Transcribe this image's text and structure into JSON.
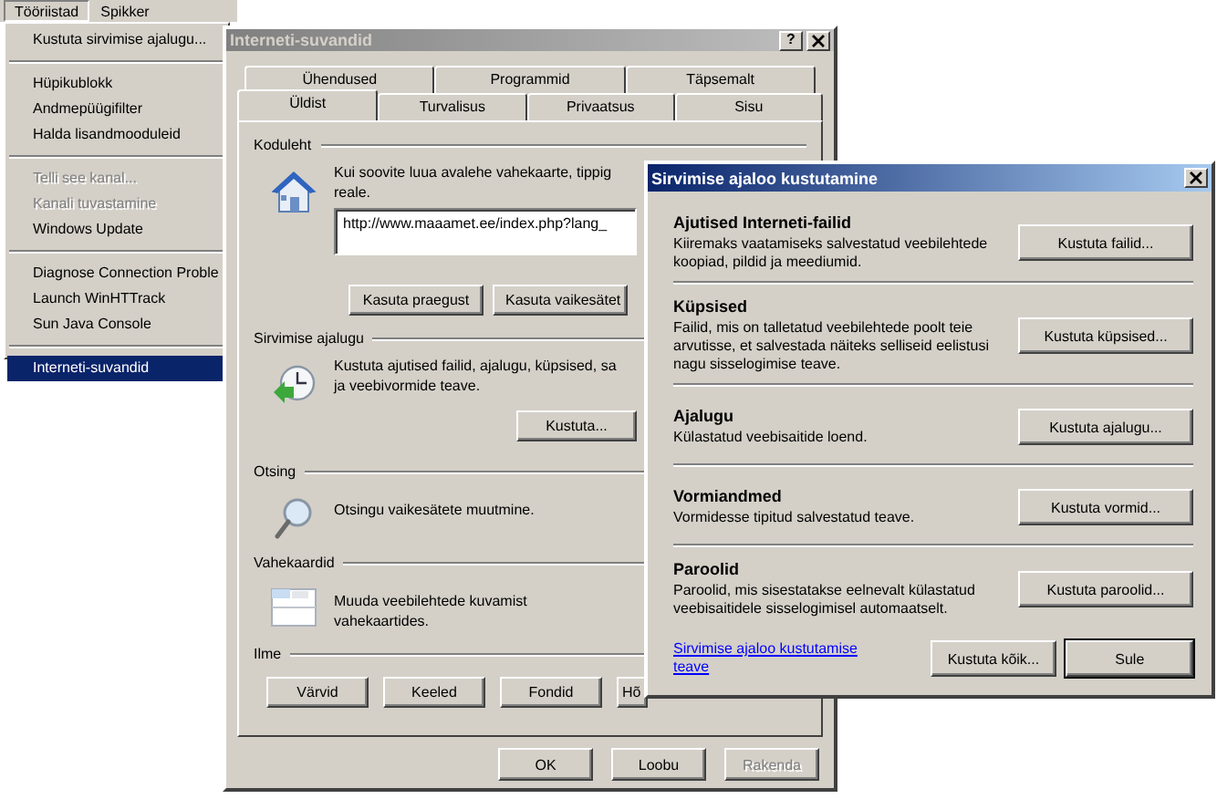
{
  "menu_bar": [
    {
      "label": "Tööriistad",
      "selected": true
    },
    {
      "label": "Spikker",
      "selected": false
    }
  ],
  "menu": {
    "groups": [
      [
        {
          "label": "Kustuta sirvimise ajalugu...",
          "disabled": false,
          "selected": false
        }
      ],
      [
        {
          "label": "Hüpikublokk",
          "disabled": false,
          "selected": false
        },
        {
          "label": "Andmepüügifilter",
          "disabled": false,
          "selected": false
        },
        {
          "label": "Halda lisandmooduleid",
          "disabled": false,
          "selected": false
        }
      ],
      [
        {
          "label": "Telli see kanal...",
          "disabled": true,
          "selected": false
        },
        {
          "label": "Kanali tuvastamine",
          "disabled": true,
          "selected": false
        },
        {
          "label": "Windows Update",
          "disabled": false,
          "selected": false
        }
      ],
      [
        {
          "label": "Diagnose Connection Proble",
          "disabled": false,
          "selected": false
        },
        {
          "label": "Launch WinHTTrack",
          "disabled": false,
          "selected": false
        },
        {
          "label": "Sun Java Console",
          "disabled": false,
          "selected": false
        }
      ],
      [
        {
          "label": "Interneti-suvandid",
          "disabled": false,
          "selected": true
        }
      ]
    ]
  },
  "options_dialog": {
    "title": "Interneti-suvandid",
    "help_button": "?",
    "tabs_row_1": [
      {
        "label": "Ühendused",
        "selected": false
      },
      {
        "label": "Programmid",
        "selected": false
      },
      {
        "label": "Täpsemalt",
        "selected": false
      }
    ],
    "tabs_row_2": [
      {
        "label": "Üldist",
        "selected": true
      },
      {
        "label": "Turvalisus",
        "selected": false
      },
      {
        "label": "Privaatsus",
        "selected": false
      },
      {
        "label": "Sisu",
        "selected": false
      }
    ],
    "sections": [
      {
        "kind": "homepage",
        "heading": "Koduleht",
        "lines": [
          "Kui soovite luua avalehe vahekaarte, tippig",
          "reale."
        ],
        "url": "http://www.maaamet.ee/index.php?lang_",
        "buttons": [
          "Kasuta praegust",
          "Kasuta vaikesätet"
        ]
      },
      {
        "kind": "history",
        "heading": "Sirvimise ajalugu",
        "lines": [
          "Kustuta ajutised failid, ajalugu, küpsised, sa",
          "ja veebivormide teave."
        ],
        "buttons": [
          "Kustuta..."
        ]
      },
      {
        "kind": "search",
        "heading": "Otsing",
        "lines": [
          "Otsingu vaikesätete muutmine."
        ]
      },
      {
        "kind": "tabs",
        "heading": "Vahekaardid",
        "lines": [
          "Muuda veebilehtede kuvamist",
          "vahekaartides."
        ]
      },
      {
        "kind": "appearance",
        "heading": "Ilme",
        "buttons": [
          "Värvid",
          "Keeled",
          "Fondid",
          "Hõ"
        ]
      }
    ],
    "buttons": [
      {
        "label": "OK",
        "disabled": false
      },
      {
        "label": "Loobu",
        "disabled": false
      },
      {
        "label": "Rakenda",
        "disabled": true
      }
    ]
  },
  "delete_dialog": {
    "title": "Sirvimise ajaloo kustutamine",
    "sections": [
      {
        "title": "Ajutised Interneti-failid",
        "text": "Kiiremaks vaatamiseks salvestatud veebilehtede koopiad, pildid ja meediumid.",
        "button": "Kustuta failid..."
      },
      {
        "title": "Küpsised",
        "text": "Failid, mis on talletatud veebilehtede poolt teie arvutisse, et salvestada näiteks selliseid eelistusi nagu sisselogimise teave.",
        "button": "Kustuta küpsised..."
      },
      {
        "title": "Ajalugu",
        "text": "Külastatud veebisaitide loend.",
        "button": "Kustuta ajalugu..."
      },
      {
        "title": "Vormiandmed",
        "text": "Vormidesse tipitud salvestatud teave.",
        "button": "Kustuta vormid..."
      },
      {
        "title": "Paroolid",
        "text": "Paroolid, mis sisestatakse eelnevalt külastatud veebisaitidele sisselogimisel automaatselt.",
        "button": "Kustuta paroolid..."
      }
    ],
    "link": "Sirvimise ajaloo kustutamise teave",
    "buttons": [
      {
        "label": "Kustuta kõik...",
        "default": false
      },
      {
        "label": "Sule",
        "default": true
      }
    ]
  }
}
